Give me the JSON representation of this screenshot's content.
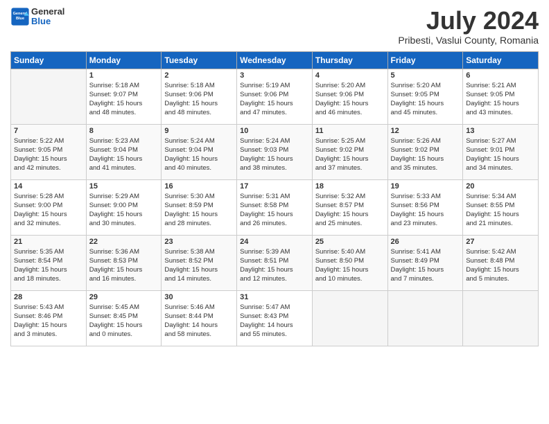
{
  "header": {
    "logo_general": "General",
    "logo_blue": "Blue",
    "month_year": "July 2024",
    "location": "Pribesti, Vaslui County, Romania"
  },
  "weekdays": [
    "Sunday",
    "Monday",
    "Tuesday",
    "Wednesday",
    "Thursday",
    "Friday",
    "Saturday"
  ],
  "weeks": [
    [
      {
        "day": "",
        "info": ""
      },
      {
        "day": "1",
        "info": "Sunrise: 5:18 AM\nSunset: 9:07 PM\nDaylight: 15 hours\nand 48 minutes."
      },
      {
        "day": "2",
        "info": "Sunrise: 5:18 AM\nSunset: 9:06 PM\nDaylight: 15 hours\nand 48 minutes."
      },
      {
        "day": "3",
        "info": "Sunrise: 5:19 AM\nSunset: 9:06 PM\nDaylight: 15 hours\nand 47 minutes."
      },
      {
        "day": "4",
        "info": "Sunrise: 5:20 AM\nSunset: 9:06 PM\nDaylight: 15 hours\nand 46 minutes."
      },
      {
        "day": "5",
        "info": "Sunrise: 5:20 AM\nSunset: 9:05 PM\nDaylight: 15 hours\nand 45 minutes."
      },
      {
        "day": "6",
        "info": "Sunrise: 5:21 AM\nSunset: 9:05 PM\nDaylight: 15 hours\nand 43 minutes."
      }
    ],
    [
      {
        "day": "7",
        "info": "Sunrise: 5:22 AM\nSunset: 9:05 PM\nDaylight: 15 hours\nand 42 minutes."
      },
      {
        "day": "8",
        "info": "Sunrise: 5:23 AM\nSunset: 9:04 PM\nDaylight: 15 hours\nand 41 minutes."
      },
      {
        "day": "9",
        "info": "Sunrise: 5:24 AM\nSunset: 9:04 PM\nDaylight: 15 hours\nand 40 minutes."
      },
      {
        "day": "10",
        "info": "Sunrise: 5:24 AM\nSunset: 9:03 PM\nDaylight: 15 hours\nand 38 minutes."
      },
      {
        "day": "11",
        "info": "Sunrise: 5:25 AM\nSunset: 9:02 PM\nDaylight: 15 hours\nand 37 minutes."
      },
      {
        "day": "12",
        "info": "Sunrise: 5:26 AM\nSunset: 9:02 PM\nDaylight: 15 hours\nand 35 minutes."
      },
      {
        "day": "13",
        "info": "Sunrise: 5:27 AM\nSunset: 9:01 PM\nDaylight: 15 hours\nand 34 minutes."
      }
    ],
    [
      {
        "day": "14",
        "info": "Sunrise: 5:28 AM\nSunset: 9:00 PM\nDaylight: 15 hours\nand 32 minutes."
      },
      {
        "day": "15",
        "info": "Sunrise: 5:29 AM\nSunset: 9:00 PM\nDaylight: 15 hours\nand 30 minutes."
      },
      {
        "day": "16",
        "info": "Sunrise: 5:30 AM\nSunset: 8:59 PM\nDaylight: 15 hours\nand 28 minutes."
      },
      {
        "day": "17",
        "info": "Sunrise: 5:31 AM\nSunset: 8:58 PM\nDaylight: 15 hours\nand 26 minutes."
      },
      {
        "day": "18",
        "info": "Sunrise: 5:32 AM\nSunset: 8:57 PM\nDaylight: 15 hours\nand 25 minutes."
      },
      {
        "day": "19",
        "info": "Sunrise: 5:33 AM\nSunset: 8:56 PM\nDaylight: 15 hours\nand 23 minutes."
      },
      {
        "day": "20",
        "info": "Sunrise: 5:34 AM\nSunset: 8:55 PM\nDaylight: 15 hours\nand 21 minutes."
      }
    ],
    [
      {
        "day": "21",
        "info": "Sunrise: 5:35 AM\nSunset: 8:54 PM\nDaylight: 15 hours\nand 18 minutes."
      },
      {
        "day": "22",
        "info": "Sunrise: 5:36 AM\nSunset: 8:53 PM\nDaylight: 15 hours\nand 16 minutes."
      },
      {
        "day": "23",
        "info": "Sunrise: 5:38 AM\nSunset: 8:52 PM\nDaylight: 15 hours\nand 14 minutes."
      },
      {
        "day": "24",
        "info": "Sunrise: 5:39 AM\nSunset: 8:51 PM\nDaylight: 15 hours\nand 12 minutes."
      },
      {
        "day": "25",
        "info": "Sunrise: 5:40 AM\nSunset: 8:50 PM\nDaylight: 15 hours\nand 10 minutes."
      },
      {
        "day": "26",
        "info": "Sunrise: 5:41 AM\nSunset: 8:49 PM\nDaylight: 15 hours\nand 7 minutes."
      },
      {
        "day": "27",
        "info": "Sunrise: 5:42 AM\nSunset: 8:48 PM\nDaylight: 15 hours\nand 5 minutes."
      }
    ],
    [
      {
        "day": "28",
        "info": "Sunrise: 5:43 AM\nSunset: 8:46 PM\nDaylight: 15 hours\nand 3 minutes."
      },
      {
        "day": "29",
        "info": "Sunrise: 5:45 AM\nSunset: 8:45 PM\nDaylight: 15 hours\nand 0 minutes."
      },
      {
        "day": "30",
        "info": "Sunrise: 5:46 AM\nSunset: 8:44 PM\nDaylight: 14 hours\nand 58 minutes."
      },
      {
        "day": "31",
        "info": "Sunrise: 5:47 AM\nSunset: 8:43 PM\nDaylight: 14 hours\nand 55 minutes."
      },
      {
        "day": "",
        "info": ""
      },
      {
        "day": "",
        "info": ""
      },
      {
        "day": "",
        "info": ""
      }
    ]
  ]
}
